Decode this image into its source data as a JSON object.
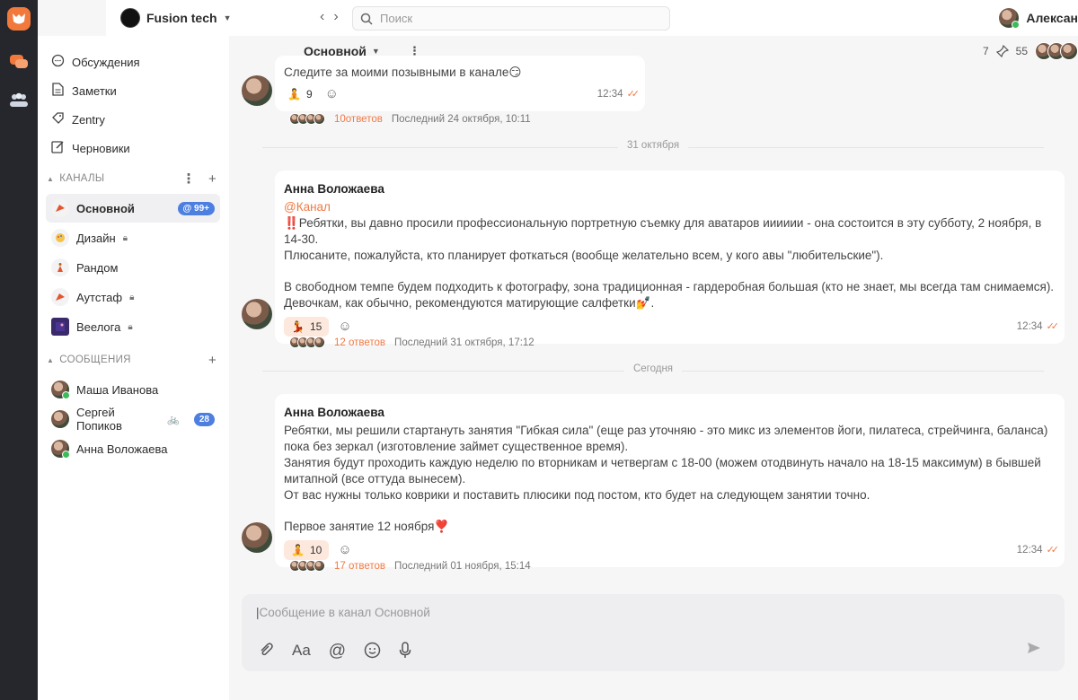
{
  "workspace": {
    "name": "Fusion tech"
  },
  "search": {
    "placeholder": "Поиск"
  },
  "user": {
    "name": "Алексан"
  },
  "nav": [
    {
      "label": "Обсуждения",
      "icon": "chat-bubble-icon"
    },
    {
      "label": "Заметки",
      "icon": "note-icon"
    },
    {
      "label": "Zentry",
      "icon": "zentry-icon"
    },
    {
      "label": "Черновики",
      "icon": "pencil-icon"
    }
  ],
  "channels_section": {
    "title": "КАНАЛЫ"
  },
  "channels": [
    {
      "name": "Основной",
      "active": true,
      "badge": "@ 99+",
      "locked": false
    },
    {
      "name": "Дизайн",
      "locked": true
    },
    {
      "name": "Рандом",
      "locked": false
    },
    {
      "name": "Аутстаф",
      "locked": true
    },
    {
      "name": "Веелога",
      "locked": true
    }
  ],
  "messages_section": {
    "title": "СООБЩЕНИЯ"
  },
  "dms": [
    {
      "name": "Маша Иванова",
      "online": true,
      "badge": ""
    },
    {
      "name": "Сергей Попиков",
      "online": false,
      "status": "🚲",
      "badge": "28"
    },
    {
      "name": "Анна Воложаева",
      "online": true,
      "badge": ""
    }
  ],
  "channel_header": {
    "name": "Основной",
    "pinned": "7",
    "members": "55"
  },
  "messages": [
    {
      "text": "Следите за моими позывными в канале😏",
      "reaction": {
        "emoji": "🧘",
        "count": "9",
        "highlight": false
      },
      "time": "12:34",
      "thread": {
        "count": "10ответов",
        "last": "Последний 24 октября, 10:11"
      }
    },
    {
      "divider": "31 октября",
      "author": "Анна Воложаева",
      "mention": "@Канал",
      "lines": [
        "‼️Ребятки, вы давно просили профессиональную портретную съемку для аватаров ииииии - она состоится в эту субботу, 2 ноября, в 14-30.",
        "Плюсаните, пожалуйста, кто планирует фоткаться (вообще желательно всем, у кого авы \"любительские\").",
        "",
        "В свободном темпе будем подходить к фотографу, зона традиционная - гардеробная большая (кто не знает, мы всегда там снимаемся). Девочкам, как обычно, рекомендуются матирующие салфетки💅."
      ],
      "reaction": {
        "emoji": "💃",
        "count": "15",
        "highlight": true
      },
      "time": "12:34",
      "thread": {
        "count": "12 ответов",
        "last": "Последний 31 октября, 17:12"
      }
    },
    {
      "divider": "Сегодня",
      "author": "Анна Воложаева",
      "lines": [
        "Ребятки, мы решили стартануть занятия \"Гибкая сила\" (еще раз уточняю - это микс из элементов йоги, пилатеса, стрейчинга, баланса) пока без зеркал (изготовление займет существенное время).",
        "Занятия будут проходить каждую неделю по вторникам и четвергам с 18-00 (можем отодвинуть начало на 18-15 максимум) в бывшей митапной (все оттуда вынесем).",
        "От вас нужны только коврики и поставить плюсики под постом, кто будет на следующем занятии точно.",
        "",
        "Первое занятие 12 ноября❣️"
      ],
      "reaction": {
        "emoji": "🧘",
        "count": "10",
        "highlight": true
      },
      "time": "12:34",
      "thread": {
        "count": "17 ответов",
        "last": "Последний 01 ноября, 15:14"
      }
    }
  ],
  "composer": {
    "placeholder": "Сообщение в канал Основной"
  }
}
